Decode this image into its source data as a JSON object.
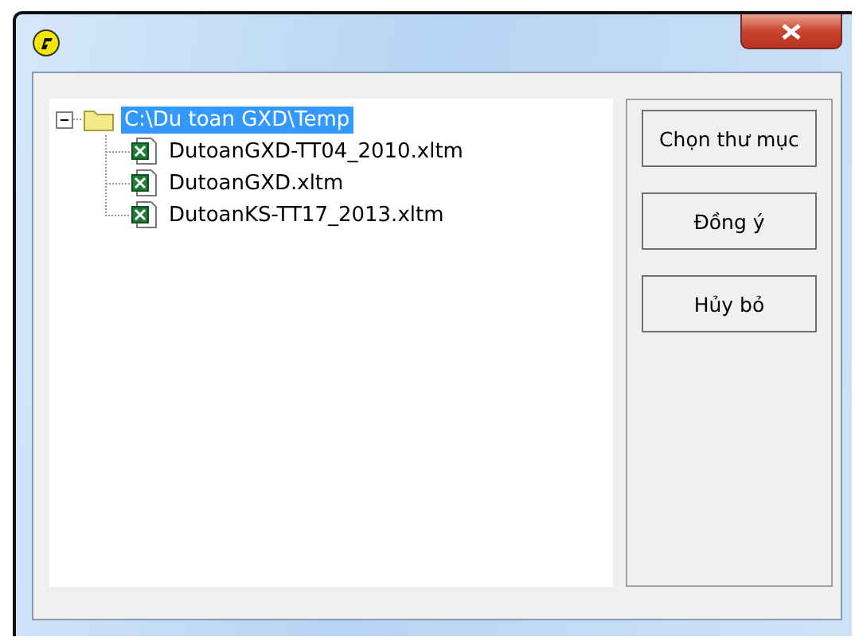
{
  "tree": {
    "label": "C:\\Du toan GXD\\Temp",
    "expanded": true,
    "selected": true,
    "children": [
      {
        "label": "DutoanGXD-TT04_2010.xltm",
        "selected": false
      },
      {
        "label": "DutoanGXD.xltm",
        "selected": false
      },
      {
        "label": "DutoanKS-TT17_2013.xltm",
        "selected": false
      }
    ]
  },
  "buttons": [
    "Chọn thư mục",
    "Đồng ý",
    "Hủy bỏ"
  ]
}
